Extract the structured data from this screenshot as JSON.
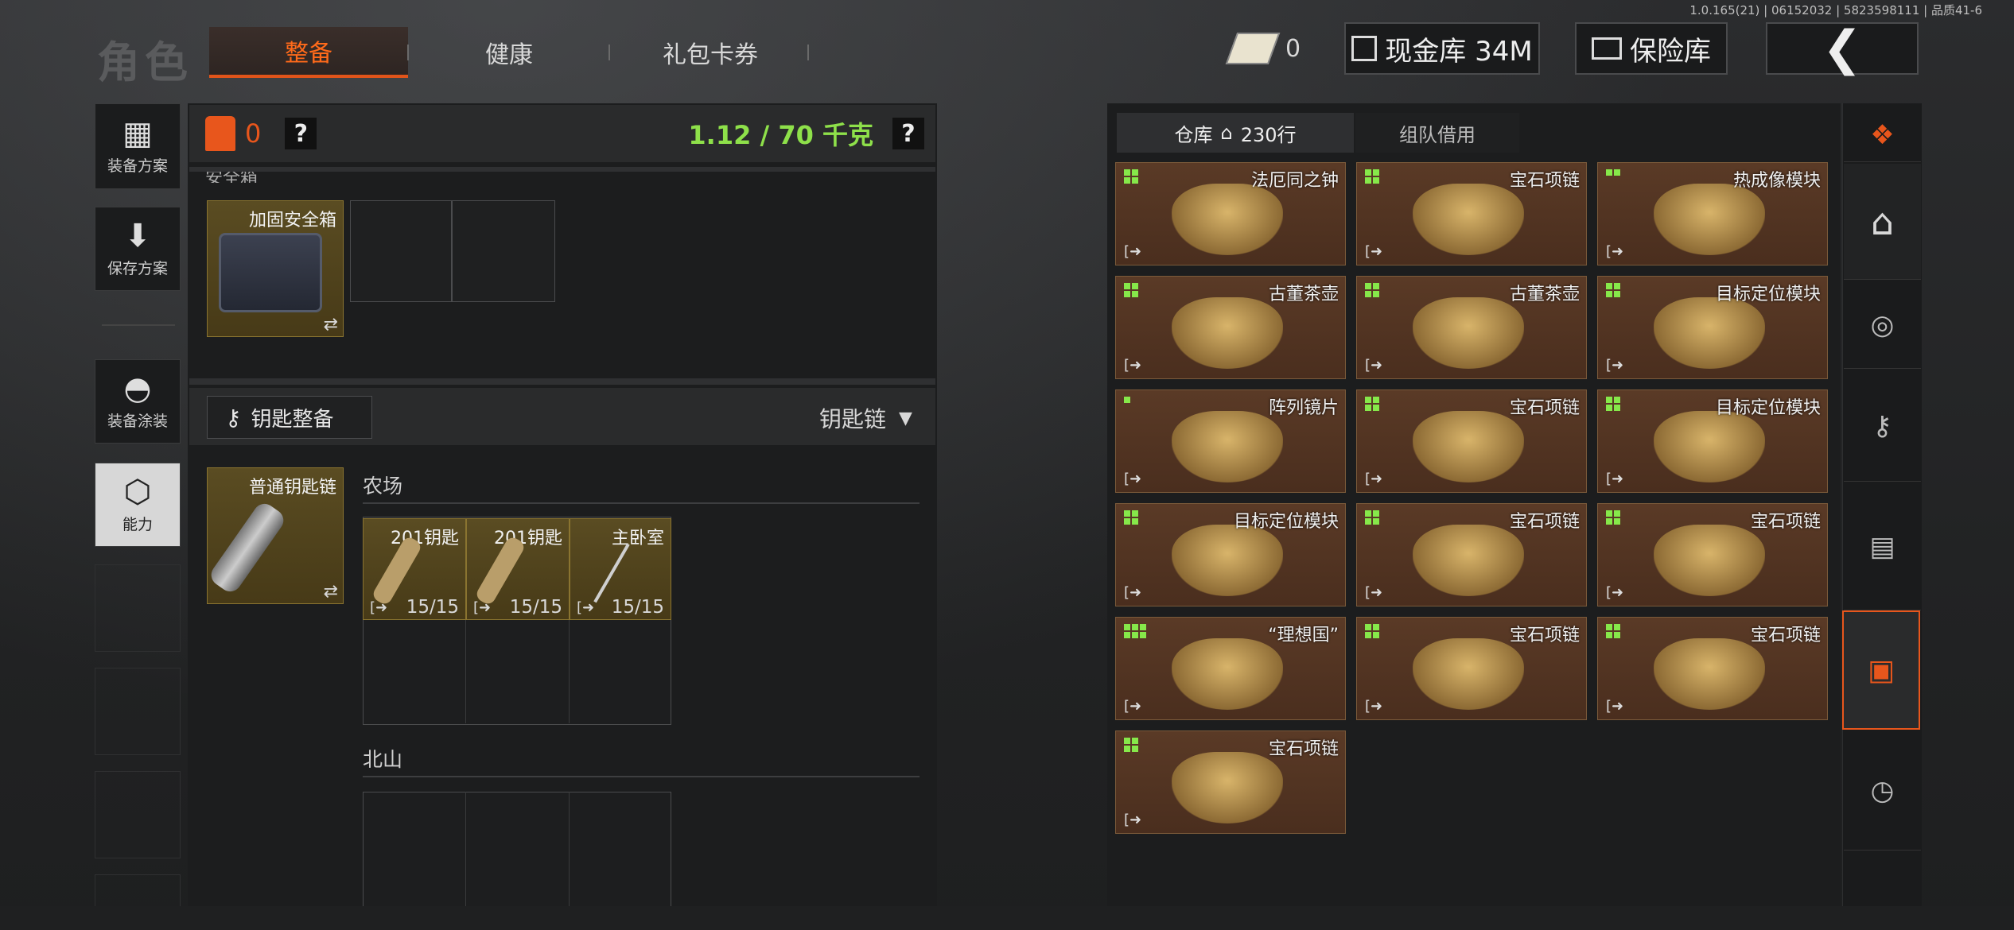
{
  "version": "1.0.165(21) | 06152032 | 5823598111 | 品质41-6",
  "role_title": "角色",
  "tabs": [
    {
      "label": "整备",
      "active": true
    },
    {
      "label": "健康",
      "active": false
    },
    {
      "label": "礼包卡券",
      "active": false
    }
  ],
  "cash_count": "0",
  "cash_vault": "现金库 34M",
  "insurance": "保险库",
  "back_icon": "chevron-left-icon",
  "side": [
    {
      "label": "装备方案",
      "icon": "vest-icon"
    },
    {
      "label": "保存方案",
      "icon": "download-icon"
    },
    {
      "label": "装备涂装",
      "icon": "helmet-icon"
    },
    {
      "label": "能力",
      "icon": "ability-icon"
    }
  ],
  "loadout": {
    "armor_count": "0",
    "help": "?",
    "weight": "1.12 / 70 千克",
    "safe_section": "安全箱",
    "safe_item": "加固安全箱"
  },
  "keys": {
    "button": "钥匙整备",
    "dropdown": "钥匙链",
    "keychain_item": "普通钥匙链",
    "farm_title": "农场",
    "farm_keys": [
      {
        "name": "201钥匙",
        "uses": "15/15"
      },
      {
        "name": "201钥匙",
        "uses": "15/15"
      },
      {
        "name": "主卧室",
        "uses": "15/15"
      }
    ],
    "north_title": "北山"
  },
  "warehouse": {
    "tab_label": "仓库",
    "tab_count": "230行",
    "tab_team": "组队借用",
    "items": [
      {
        "name": "法厄同之钟",
        "pips": 4
      },
      {
        "name": "宝石项链",
        "pips": 4
      },
      {
        "name": "热成像模块",
        "pips": 2
      },
      {
        "name": "古董茶壶",
        "pips": 4
      },
      {
        "name": "古董茶壶",
        "pips": 4
      },
      {
        "name": "目标定位模块",
        "pips": 4
      },
      {
        "name": "阵列镜片",
        "pips": 1
      },
      {
        "name": "宝石项链",
        "pips": 4
      },
      {
        "name": "目标定位模块",
        "pips": 4
      },
      {
        "name": "目标定位模块",
        "pips": 4
      },
      {
        "name": "宝石项链",
        "pips": 4
      },
      {
        "name": "宝石项链",
        "pips": 4
      },
      {
        "name": "“理想国”",
        "pips": 6
      },
      {
        "name": "宝石项链",
        "pips": 4
      },
      {
        "name": "宝石项链",
        "pips": 4
      },
      {
        "name": "宝石项链",
        "pips": 4
      }
    ]
  },
  "right_icons": [
    "layers-refresh-icon",
    "home-icon",
    "coin-icon",
    "key-icon",
    "cash-icon",
    "box-down-icon",
    "clock-icon"
  ],
  "colors": {
    "accent": "#e8561c",
    "weight": "#8ee04a",
    "pip": "#86e84a"
  }
}
